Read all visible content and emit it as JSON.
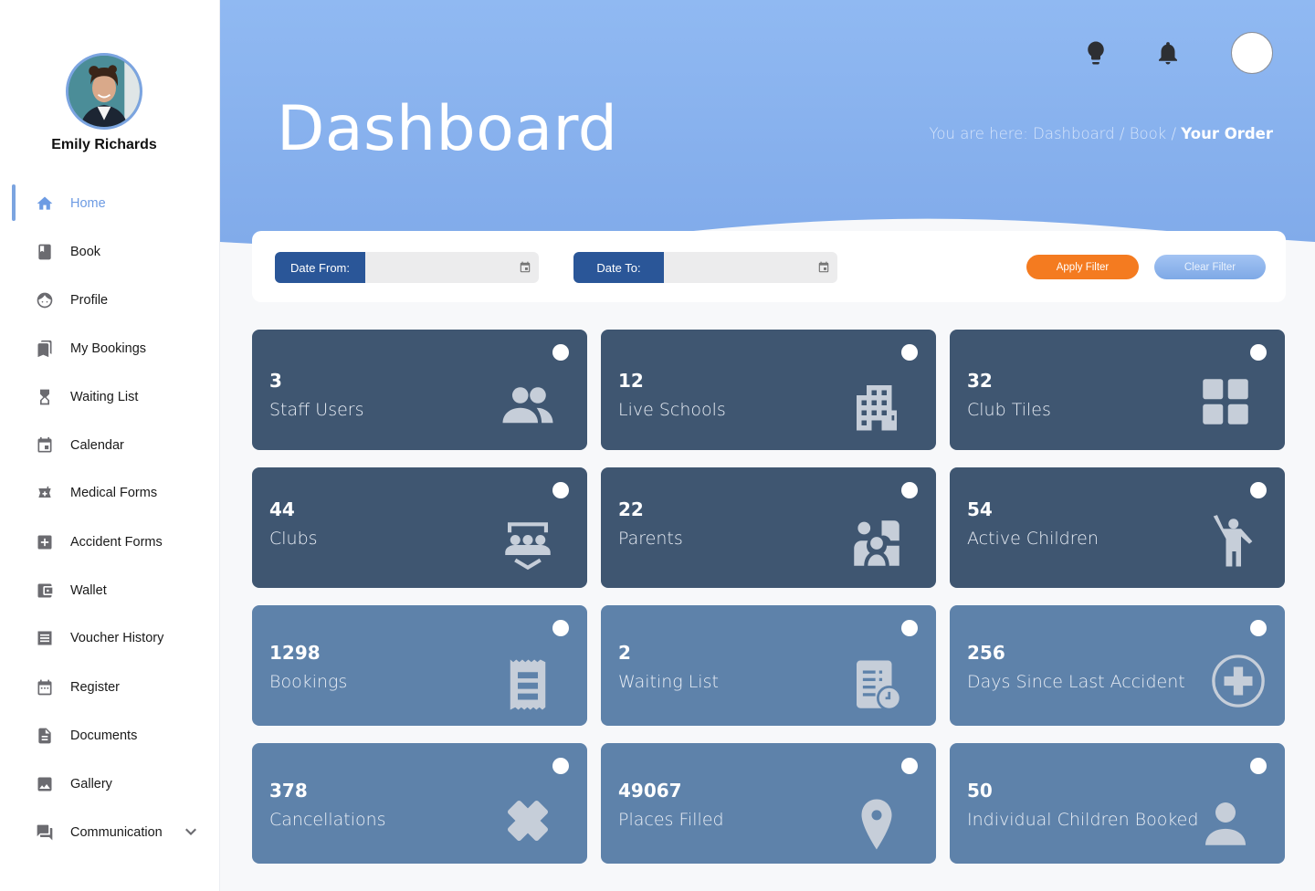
{
  "user": {
    "name": "Emily Richards"
  },
  "sidebar": {
    "items": [
      {
        "label": "Home",
        "icon": "home-icon",
        "active": true
      },
      {
        "label": "Book",
        "icon": "book-icon"
      },
      {
        "label": "Profile",
        "icon": "face-icon"
      },
      {
        "label": "My Bookings",
        "icon": "bookmarks-icon"
      },
      {
        "label": "Waiting List",
        "icon": "hourglass-icon"
      },
      {
        "label": "Calendar",
        "icon": "calendar-icon"
      },
      {
        "label": "Medical Forms",
        "icon": "medical-icon"
      },
      {
        "label": "Accident Forms",
        "icon": "plus-box-icon"
      },
      {
        "label": "Wallet",
        "icon": "wallet-icon"
      },
      {
        "label": "Voucher History",
        "icon": "receipt-icon"
      },
      {
        "label": "Register",
        "icon": "calendar-dots-icon"
      },
      {
        "label": "Documents",
        "icon": "document-icon"
      },
      {
        "label": "Gallery",
        "icon": "image-icon"
      },
      {
        "label": "Communication",
        "icon": "chat-icon",
        "expandable": true
      }
    ]
  },
  "header": {
    "title": "Dashboard",
    "breadcrumb": {
      "prefix": "You are here: ",
      "trail": "Dashboard / Book / ",
      "current": "Your Order"
    },
    "icons": [
      "lightbulb-icon",
      "bell-icon",
      "user-avatar"
    ]
  },
  "filter": {
    "date_from_label": "Date From:",
    "date_from_value": "",
    "date_to_label": "Date To:",
    "date_to_value": "",
    "apply_label": "Apply Filter",
    "clear_label": "Clear Filter"
  },
  "colors": {
    "accent": "#7ba4e0",
    "header_bg": "#8ab3ee",
    "date_label_bg": "#2a5698",
    "apply": "#f47b20",
    "card_dark": "#3f5671",
    "card_light": "#5e82aa"
  },
  "cards": [
    {
      "value": "3",
      "label": "Staff Users",
      "icon": "people-icon",
      "tone": "dark"
    },
    {
      "value": "12",
      "label": "Live Schools",
      "icon": "building-icon",
      "tone": "dark"
    },
    {
      "value": "32",
      "label": "Club Tiles",
      "icon": "grid-icon",
      "tone": "dark"
    },
    {
      "value": "44",
      "label": "Clubs",
      "icon": "group-shield-icon",
      "tone": "dark"
    },
    {
      "value": "22",
      "label": "Parents",
      "icon": "family-icon",
      "tone": "dark"
    },
    {
      "value": "54",
      "label": "Active Children",
      "icon": "child-waving-icon",
      "tone": "dark"
    },
    {
      "value": "1298",
      "label": "Bookings",
      "icon": "receipt-icon",
      "tone": "light"
    },
    {
      "value": "2",
      "label": "Waiting List",
      "icon": "list-clock-icon",
      "tone": "light"
    },
    {
      "value": "256",
      "label": "Days Since Last Accident",
      "icon": "medical-cross-icon",
      "tone": "light"
    },
    {
      "value": "378",
      "label": "Cancellations",
      "icon": "x-icon",
      "tone": "light"
    },
    {
      "value": "49067",
      "label": "Places Filled",
      "icon": "location-pin-icon",
      "tone": "light"
    },
    {
      "value": "50",
      "label": "Individual Children Booked",
      "icon": "person-icon",
      "tone": "light"
    }
  ]
}
